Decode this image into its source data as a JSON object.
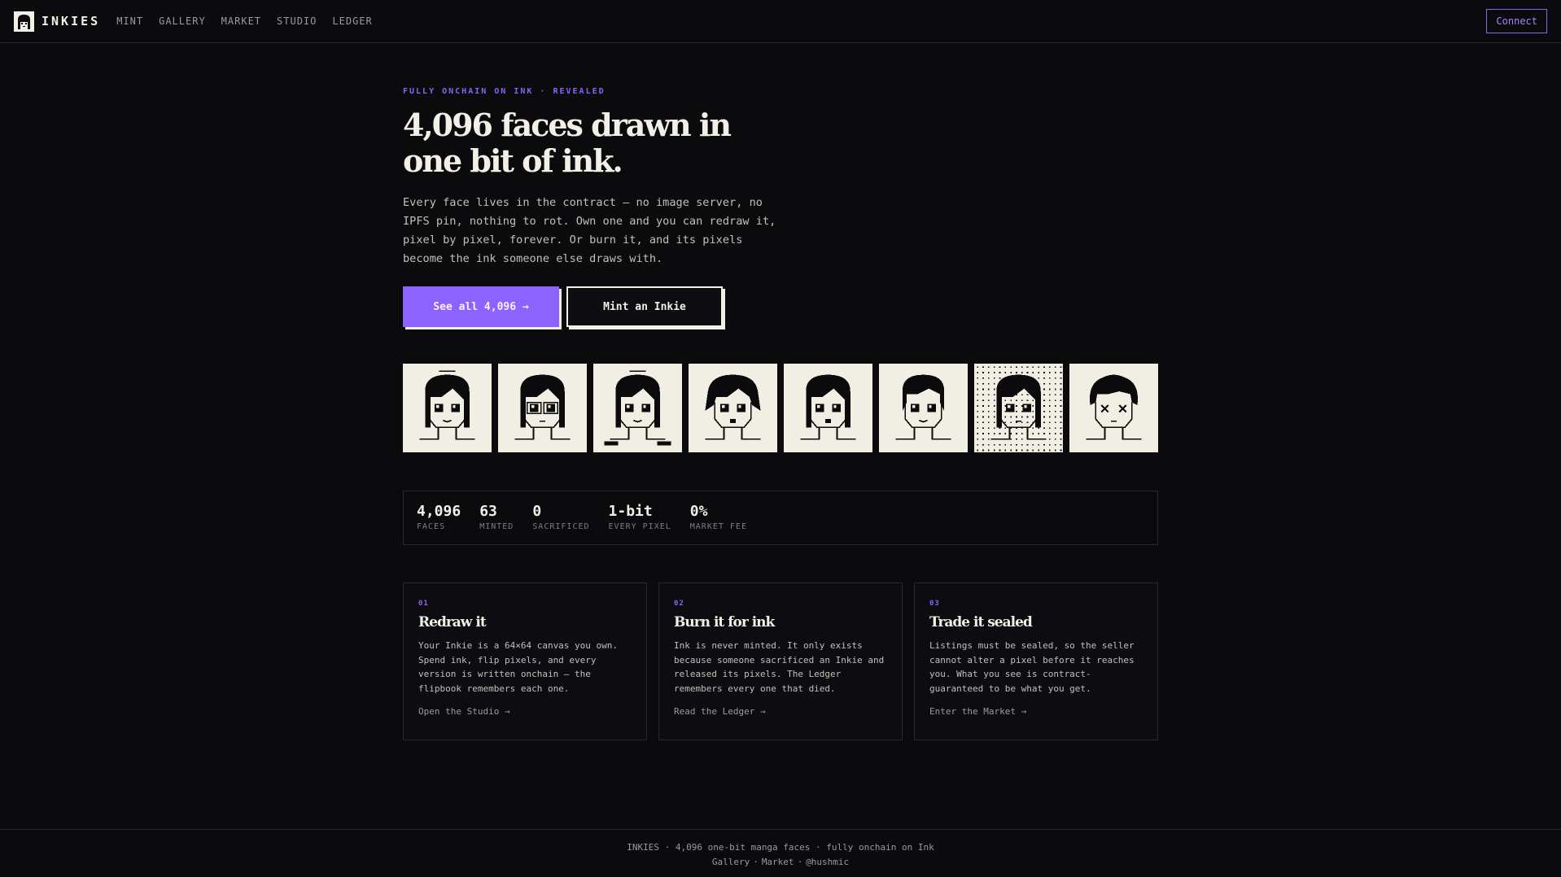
{
  "brand": {
    "name": "INKIES",
    "logo_icon": "manga-face-icon"
  },
  "nav": {
    "items": [
      {
        "label": "MINT"
      },
      {
        "label": "GALLERY"
      },
      {
        "label": "MARKET"
      },
      {
        "label": "STUDIO"
      },
      {
        "label": "LEDGER"
      }
    ],
    "connect_label": "Connect"
  },
  "hero": {
    "kicker": "FULLY ONCHAIN ON INK · REVEALED",
    "headline_line1": "4,096 faces drawn in",
    "headline_line2": "one bit of ink.",
    "intro": "Every face lives in the contract — no image server, no IPFS pin, nothing to rot. Own one and you can redraw it, pixel by pixel, forever. Or burn it, and its pixels become the ink someone else draws with.",
    "primary_cta": "See all 4,096 →",
    "secondary_cta": "Mint an Inkie"
  },
  "faces": [
    {
      "name": "face-1"
    },
    {
      "name": "face-2"
    },
    {
      "name": "face-3"
    },
    {
      "name": "face-4"
    },
    {
      "name": "face-5"
    },
    {
      "name": "face-6"
    },
    {
      "name": "face-7"
    },
    {
      "name": "face-8"
    }
  ],
  "stats": [
    {
      "value": "4,096",
      "label": "FACES"
    },
    {
      "value": "63",
      "label": "MINTED"
    },
    {
      "value": "0",
      "label": "SACRIFICED"
    },
    {
      "value": "1-bit",
      "label": "EVERY PIXEL"
    },
    {
      "value": "0%",
      "label": "MARKET FEE"
    }
  ],
  "cards": [
    {
      "num": "01",
      "title": "Redraw it",
      "body": "Your Inkie is a 64×64 canvas you own. Spend ink, flip pixels, and every version is written onchain — the flipbook remembers each one.",
      "link": "Open the Studio →"
    },
    {
      "num": "02",
      "title": "Burn it for ink",
      "body": "Ink is never minted. It only exists because someone sacrificed an Inkie and released its pixels. The Ledger remembers every one that died.",
      "link": "Read the Ledger →"
    },
    {
      "num": "03",
      "title": "Trade it sealed",
      "body": "Listings must be sealed, so the seller cannot alter a pixel before it reaches you. What you see is contract-guaranteed to be what you get.",
      "link": "Enter the Market →"
    }
  ],
  "footer": {
    "line1": "INKIES · 4,096 one-bit manga faces · fully onchain on Ink",
    "links": [
      "Gallery",
      "Market",
      "@hushmic"
    ]
  },
  "colors": {
    "background": "#0b0a0d",
    "accent": "#8d63ff",
    "paper": "#f1eee4",
    "ink": "#0b0a0d"
  }
}
